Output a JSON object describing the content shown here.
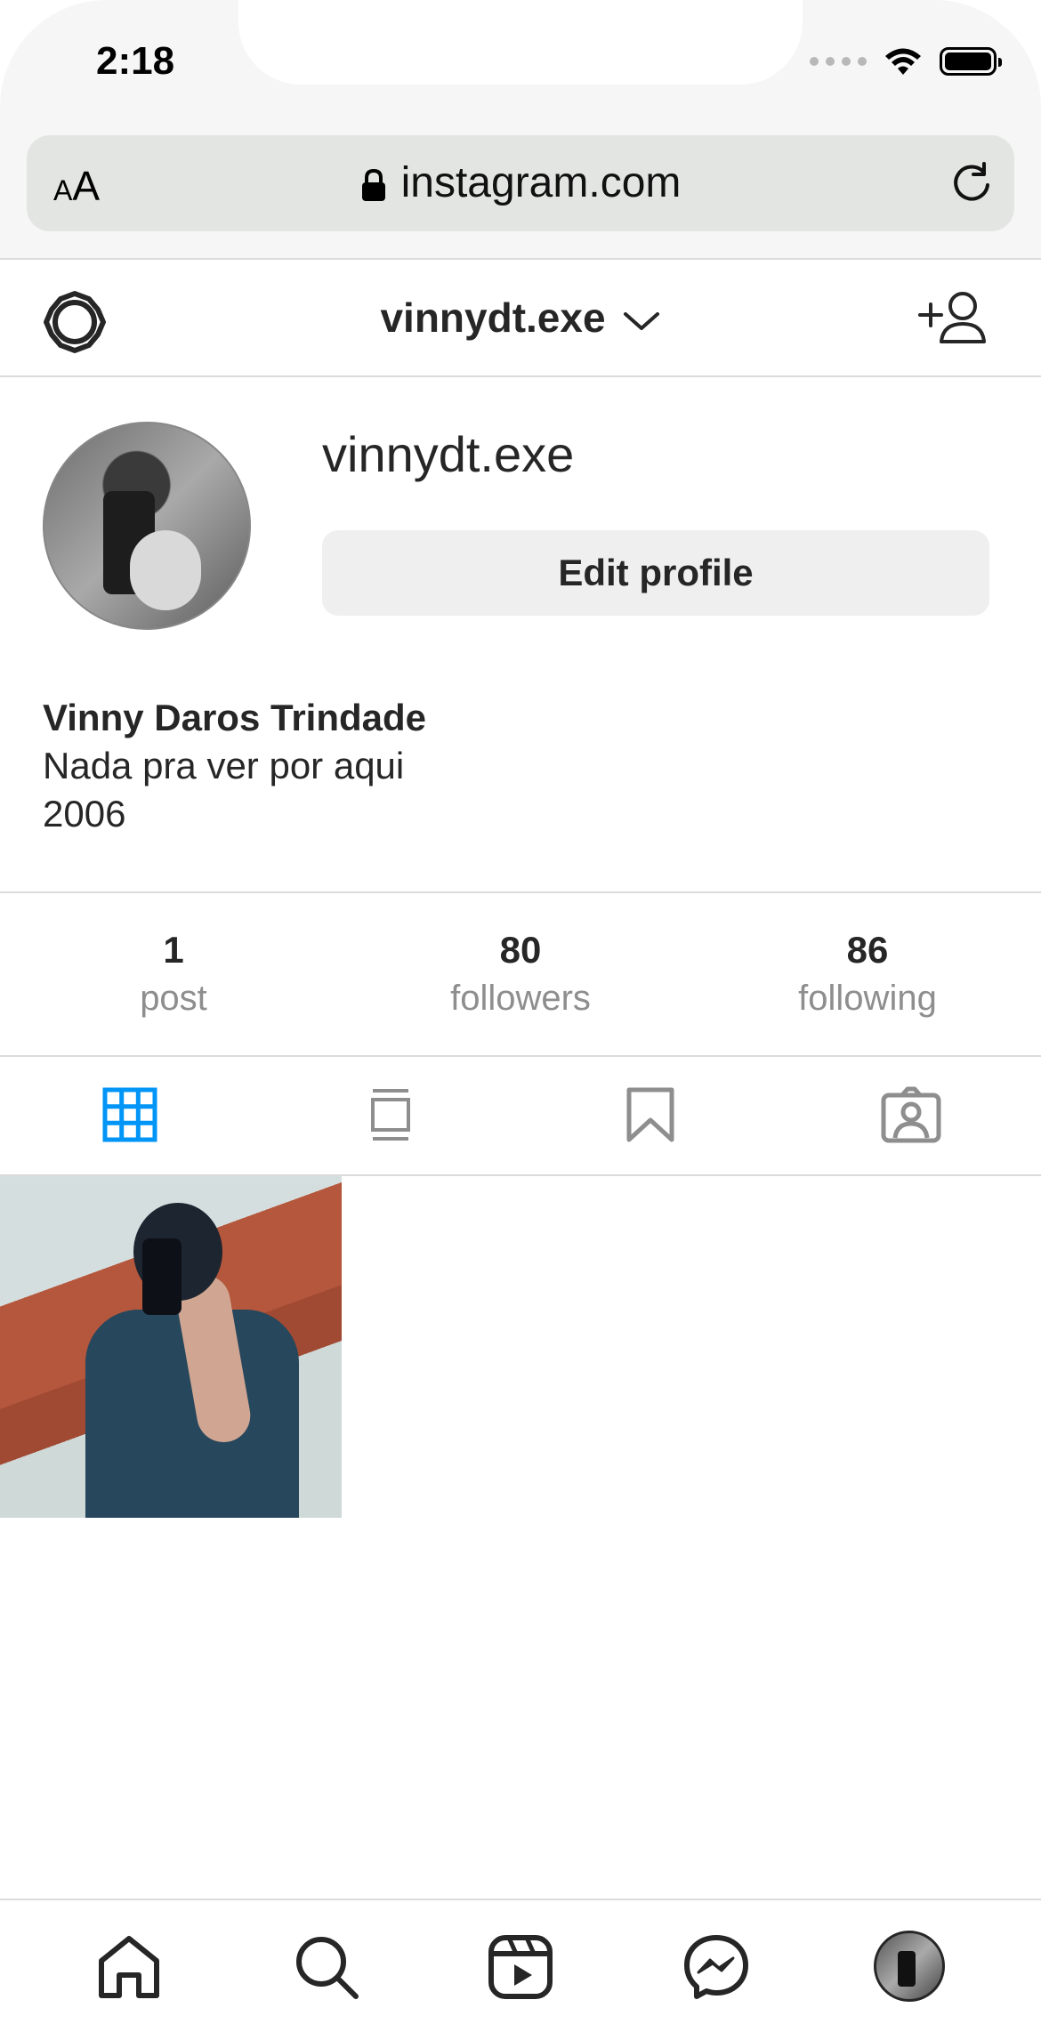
{
  "status_bar": {
    "time": "2:18"
  },
  "browser": {
    "text_size_label": "AA",
    "url": "instagram.com"
  },
  "header": {
    "username": "vinnydt.exe"
  },
  "profile": {
    "username": "vinnydt.exe",
    "edit_button": "Edit profile",
    "full_name": "Vinny Daros Trindade",
    "bio_line1": "Nada pra ver por aqui",
    "bio_line2": "2006"
  },
  "stats": [
    {
      "value": "1",
      "label": "post"
    },
    {
      "value": "80",
      "label": "followers"
    },
    {
      "value": "86",
      "label": "following"
    }
  ],
  "tabs": [
    "grid-icon",
    "feed-icon",
    "bookmark-icon",
    "tagged-icon"
  ],
  "colors": {
    "accent": "#0095f6",
    "text": "#262626",
    "muted": "#8e8e8e",
    "divider": "#dbdbdb"
  },
  "bottom_nav": [
    "home-icon",
    "search-icon",
    "reels-icon",
    "messenger-icon",
    "profile-avatar"
  ]
}
